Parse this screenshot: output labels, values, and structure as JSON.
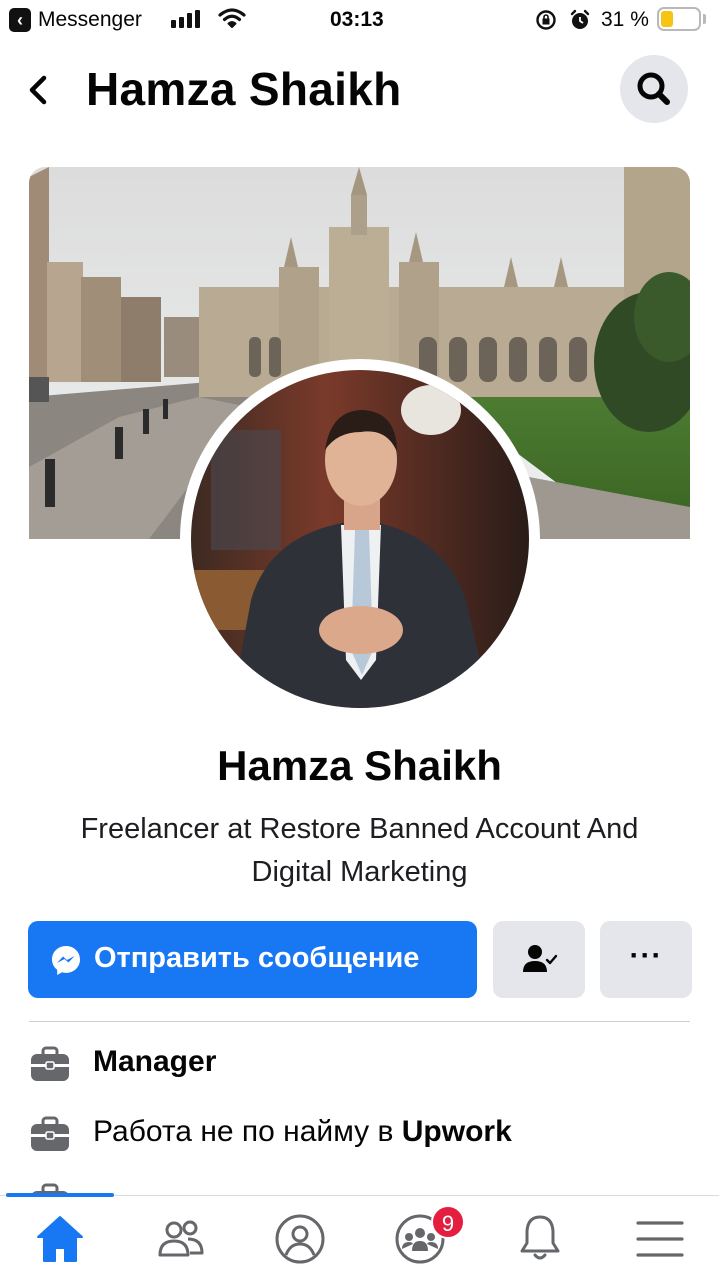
{
  "status_bar": {
    "back_app": "Messenger",
    "time": "03:13",
    "battery": "31 %",
    "battery_level": 0.31
  },
  "header": {
    "title": "Hamza Shaikh"
  },
  "profile": {
    "name": "Hamza Shaikh",
    "bio": "Freelancer at Restore Banned Account And Digital Marketing"
  },
  "actions": {
    "message_label": "Отправить сообщение",
    "more_label": "···"
  },
  "info": [
    {
      "icon": "briefcase-icon",
      "text": "Manager",
      "bold": ""
    },
    {
      "icon": "briefcase-icon",
      "text": "Работа не по найму в ",
      "bold": "Upwork"
    }
  ],
  "tabbar": {
    "items": [
      "home-icon",
      "friends-icon",
      "profile-icon",
      "groups-icon",
      "notifications-icon",
      "menu-icon"
    ],
    "active": "home-icon",
    "groups_badge": "9"
  },
  "colors": {
    "accent": "#1877f2",
    "badge": "#e41e3f",
    "button_gray": "#e4e6eb"
  }
}
